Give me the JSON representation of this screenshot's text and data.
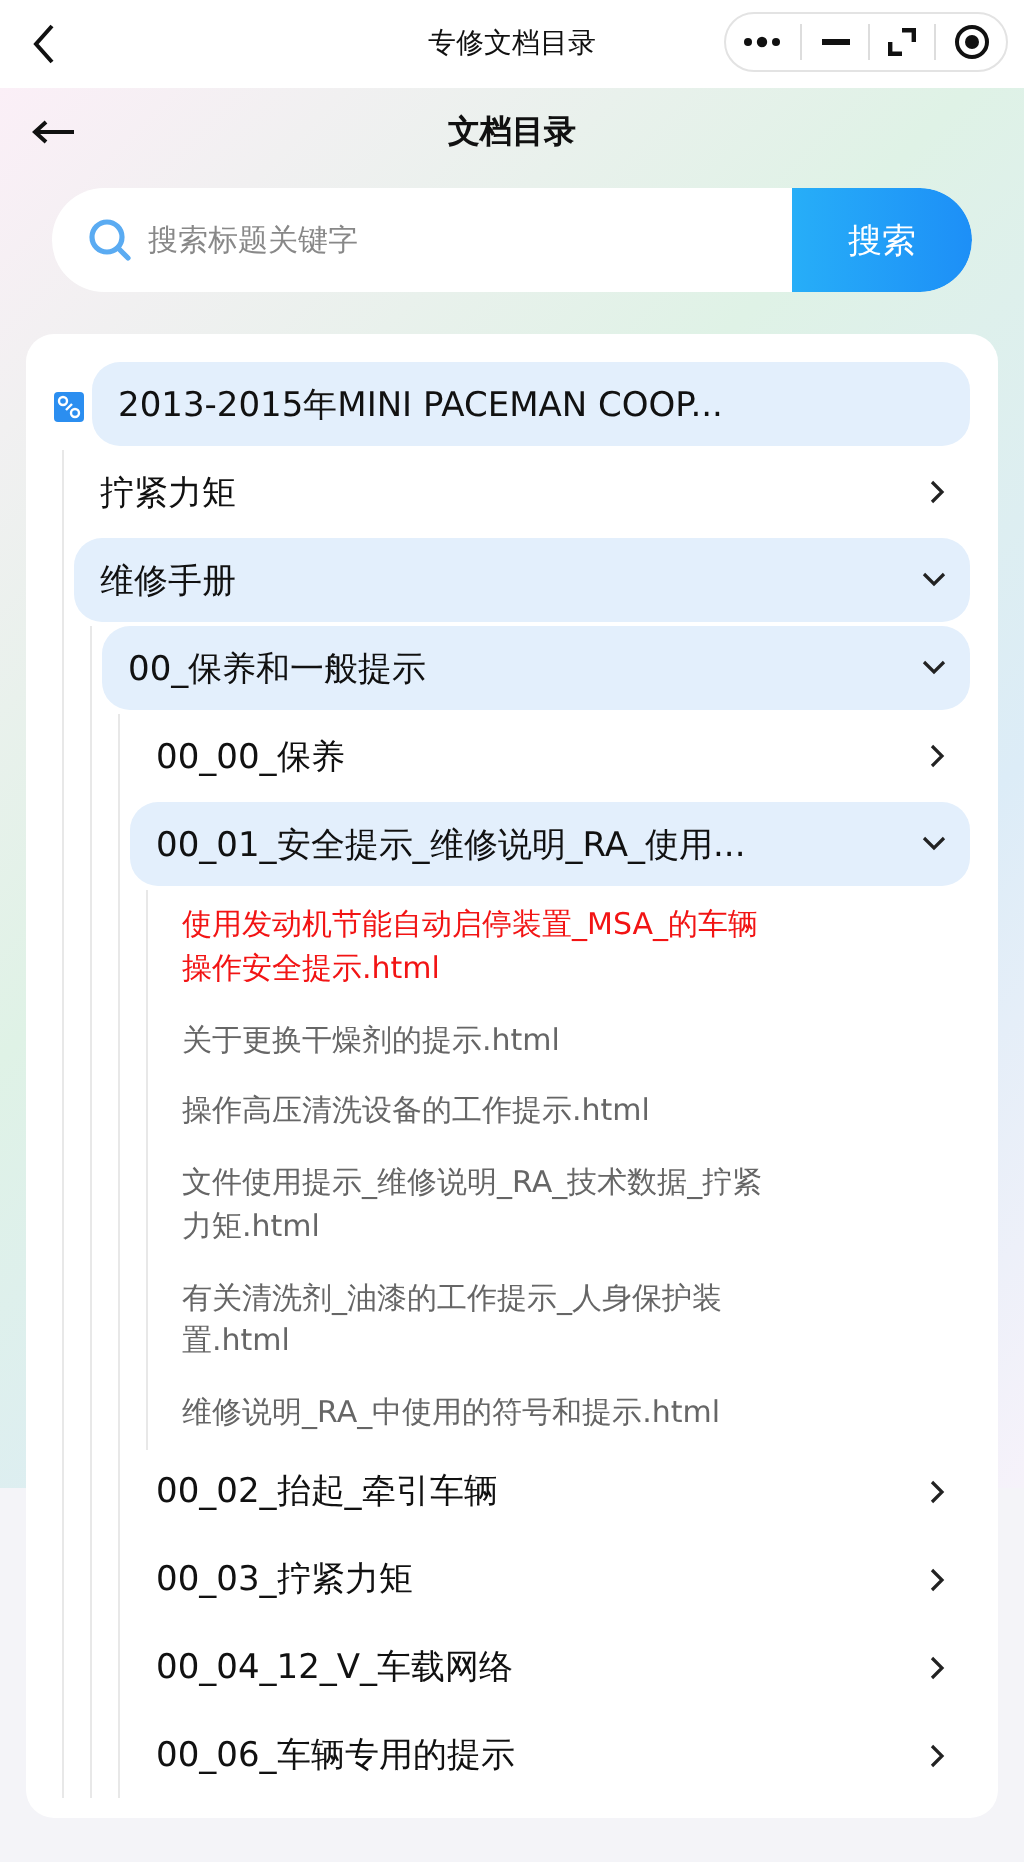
{
  "top_bar": {
    "title": "专修文档目录"
  },
  "header": {
    "title": "文档目录"
  },
  "search": {
    "placeholder": "搜索标题关键字",
    "button": "搜索"
  },
  "tree": {
    "label": "2013-2015年MINI PACEMAN COOP...",
    "expanded": true,
    "children": [
      {
        "kind": "folder",
        "label": "拧紧力矩",
        "expanded": false
      },
      {
        "kind": "folder",
        "label": "维修手册",
        "expanded": true,
        "children": [
          {
            "kind": "folder",
            "label": "00_保养和一般提示",
            "expanded": true,
            "children": [
              {
                "kind": "folder",
                "label": "00_00_保养",
                "expanded": false
              },
              {
                "kind": "folder",
                "label": "00_01_安全提示_维修说明_RA_使用...",
                "expanded": true,
                "children": [
                  {
                    "kind": "file",
                    "label": "使用发动机节能自动启停装置_MSA_的车辆操作安全提示.html",
                    "selected": true
                  },
                  {
                    "kind": "file",
                    "label": "关于更换干燥剂的提示.html",
                    "selected": false
                  },
                  {
                    "kind": "file",
                    "label": "操作高压清洗设备的工作提示.html",
                    "selected": false
                  },
                  {
                    "kind": "file",
                    "label": "文件使用提示_维修说明_RA_技术数据_拧紧力矩.html",
                    "selected": false
                  },
                  {
                    "kind": "file",
                    "label": "有关清洗剂_油漆的工作提示_人身保护装置.html",
                    "selected": false
                  },
                  {
                    "kind": "file",
                    "label": "维修说明_RA_中使用的符号和提示.html",
                    "selected": false
                  }
                ]
              },
              {
                "kind": "folder",
                "label": "00_02_抬起_牵引车辆",
                "expanded": false
              },
              {
                "kind": "folder",
                "label": "00_03_拧紧力矩",
                "expanded": false
              },
              {
                "kind": "folder",
                "label": "00_04_12_V_车载网络",
                "expanded": false
              },
              {
                "kind": "folder",
                "label": "00_06_车辆专用的提示",
                "expanded": false
              }
            ]
          }
        ]
      }
    ]
  }
}
